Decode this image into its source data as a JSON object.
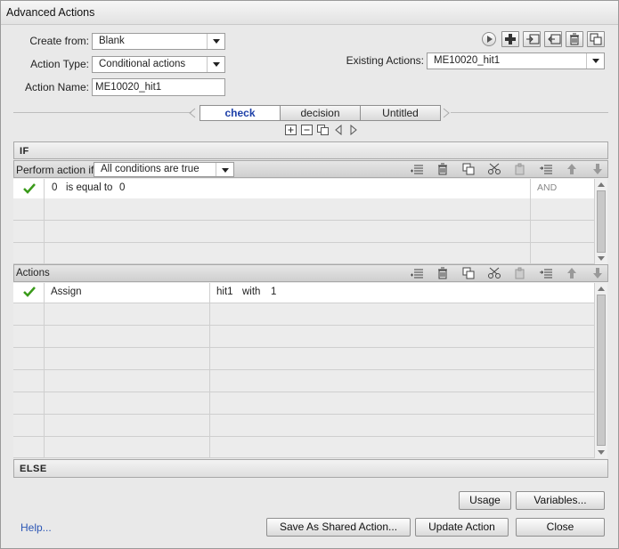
{
  "window": {
    "title": "Advanced Actions"
  },
  "form": {
    "create_from_label": "Create from:",
    "create_from_value": "Blank",
    "action_type_label": "Action Type:",
    "action_type_value": "Conditional actions",
    "action_name_label": "Action Name:",
    "action_name_value": "ME10020_hit1",
    "existing_actions_label": "Existing Actions:",
    "existing_actions_value": "ME10020_hit1"
  },
  "tabs": [
    {
      "label": "check",
      "active": true
    },
    {
      "label": "decision",
      "active": false
    },
    {
      "label": "Untitled",
      "active": false
    }
  ],
  "if_section": {
    "header": "IF",
    "perform_label": "Perform action if:",
    "perform_value": "All conditions are true",
    "conditions": [
      {
        "checked": true,
        "left": "0",
        "operator": "is equal to",
        "right": "0",
        "logic": "AND"
      },
      {
        "checked": false,
        "left": "",
        "operator": "",
        "right": "",
        "logic": ""
      },
      {
        "checked": false,
        "left": "",
        "operator": "",
        "right": "",
        "logic": ""
      },
      {
        "checked": false,
        "left": "",
        "operator": "",
        "right": "",
        "logic": ""
      }
    ]
  },
  "actions_section": {
    "header": "Actions",
    "rows": [
      {
        "checked": true,
        "action": "Assign",
        "target": "hit1",
        "with_label": "with",
        "value": "1"
      },
      {
        "checked": false,
        "action": "",
        "target": "",
        "with_label": "",
        "value": ""
      },
      {
        "checked": false,
        "action": "",
        "target": "",
        "with_label": "",
        "value": ""
      },
      {
        "checked": false,
        "action": "",
        "target": "",
        "with_label": "",
        "value": ""
      },
      {
        "checked": false,
        "action": "",
        "target": "",
        "with_label": "",
        "value": ""
      },
      {
        "checked": false,
        "action": "",
        "target": "",
        "with_label": "",
        "value": ""
      },
      {
        "checked": false,
        "action": "",
        "target": "",
        "with_label": "",
        "value": ""
      },
      {
        "checked": false,
        "action": "",
        "target": "",
        "with_label": "",
        "value": ""
      }
    ]
  },
  "else_section": {
    "header": "ELSE"
  },
  "buttons": {
    "usage": "Usage",
    "variables": "Variables...",
    "help": "Help...",
    "save_shared": "Save As Shared Action...",
    "update": "Update Action",
    "close": "Close"
  },
  "toolbar_icons": [
    "preview-icon",
    "add-icon",
    "import-icon",
    "export-icon",
    "delete-icon",
    "duplicate-icon"
  ],
  "colors": {
    "accent": "#1d3fa8",
    "link": "#2b56b5",
    "check": "#3a9a1a"
  }
}
